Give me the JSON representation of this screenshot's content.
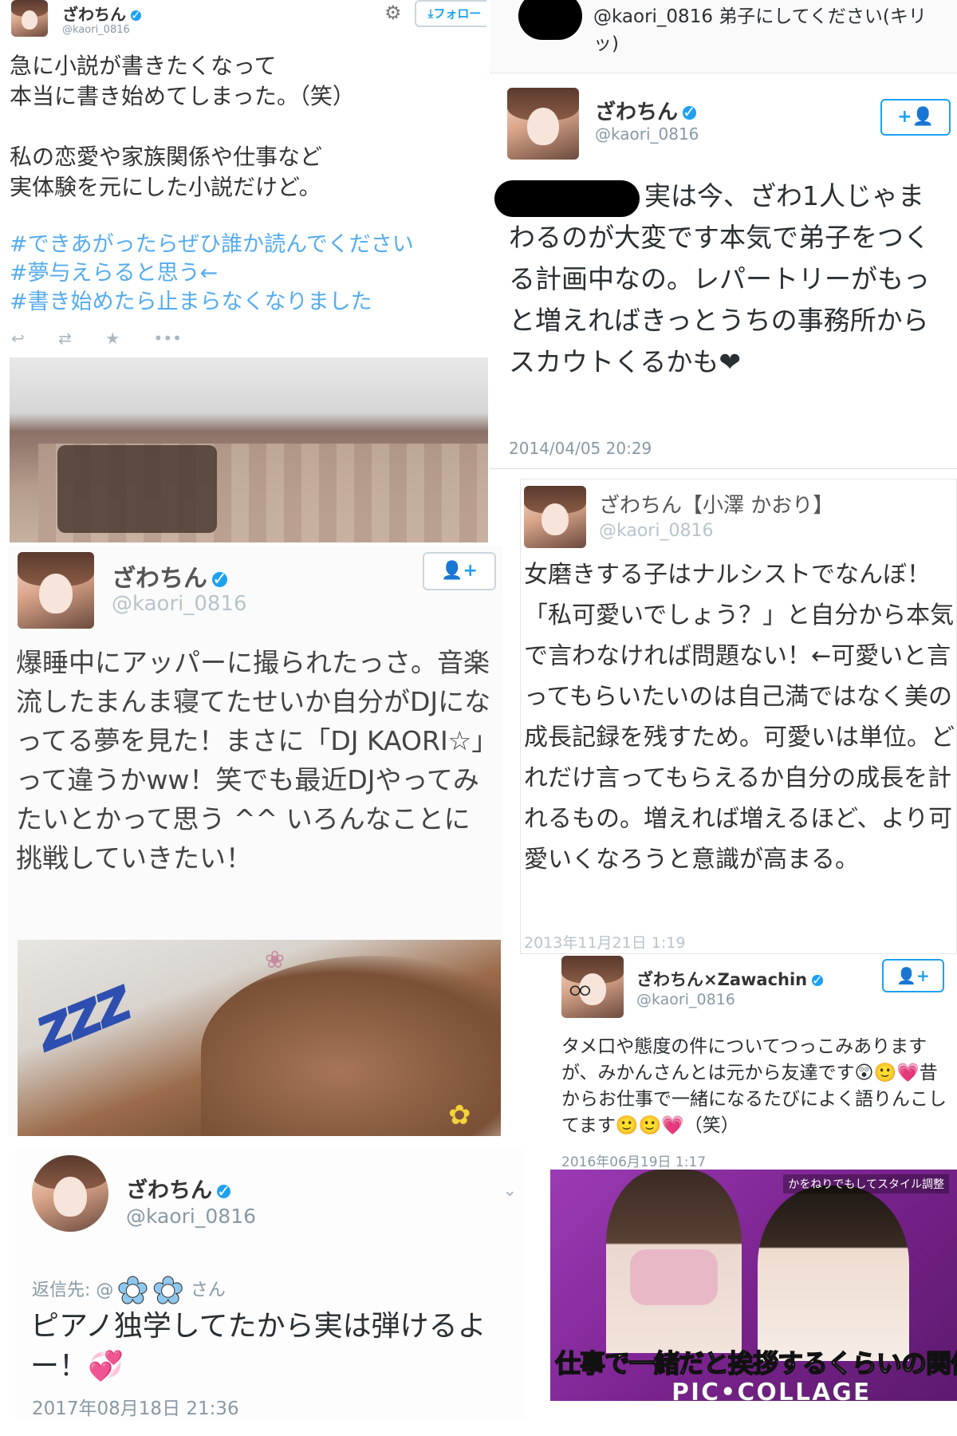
{
  "tweet_novel": {
    "name": "ざわちん",
    "handle": "@kaori_0816",
    "follow_label": "フォロー",
    "body": "急に小説が書きたくなって\n本当に書き始めてしまった。（笑）\n\n私の恋愛や家族関係や仕事など\n実体験を元にした小説だけど。",
    "hashtags": "#できあがったらぜひ誰か読んでください\n#夢与えらると思う←\n#書き始めたら止まらなくなりました"
  },
  "tweet_reply_top": {
    "text": "@kaori_0816 弟子にしてください(キリッ)"
  },
  "tweet_disciple": {
    "name": "ざわちん",
    "handle": "@kaori_0816",
    "body": "実は今、ざわ1人じゃまわるのが大変です本気で弟子をつくる計画中なの。レパートリーがもっと増えればきっとうちの事務所からスカウトくるかも❤",
    "timestamp": "2014/04/05 20:29"
  },
  "tweet_narcissist": {
    "name": "ざわちん【小澤 かおり】",
    "handle": "@kaori_0816",
    "body": "女磨きする子はナルシストでなんぼ！「私可愛いでしょう？」と自分から本気で言わなければ問題ない！←可愛いと言ってもらいたいのは自己満ではなく美の成長記録を残すため。可愛いは単位。どれだけ言ってもらえるか自分の成長を計れるもの。増えれば増えるほど、より可愛いくなろうと意識が高まる。",
    "timestamp": "2013年11月21日 1:19"
  },
  "tweet_dj": {
    "name": "ざわちん",
    "handle": "@kaori_0816",
    "body": "爆睡中にアッパーに撮られたっさ。音楽流したまんま寝てたせいか自分がDJになってる夢を見た！まさに「DJ KAORI☆」って違うかww！笑でも最近DJやってみたいとかって思う ^^ いろんなことに挑戦していきたい！",
    "image_text": "zzz"
  },
  "tweet_mikan": {
    "name": "ざわちん×Zawachin",
    "handle": "@kaori_0816",
    "body": "タメ口や態度の件についてつっこみありますが、みかんさんとは元から友達です😲🙂💗昔からお仕事で一緒になるたびによく語りんこしてます🙂🙂💗（笑）",
    "timestamp": "2016年06月19日 1:17"
  },
  "tweet_piano": {
    "name": "ざわちん",
    "handle": "@kaori_0816",
    "reply_prefix": "返信先: @",
    "reply_suffix": "さん",
    "body": "ピアノ独学してたから実は弾けるよー！💞",
    "timestamp": "2017年08月18日 21:36"
  },
  "tv_caption": {
    "text": "仕事で一緒だと挨拶するくらいの関係",
    "corner_text": "かをねりでもしてスタイル調整"
  },
  "watermark": "PIC•COLLAGE",
  "colors": {
    "twitter_blue": "#1da1f2",
    "hashtag_blue": "#55acee",
    "tv_purple": "#8a2aa0"
  }
}
